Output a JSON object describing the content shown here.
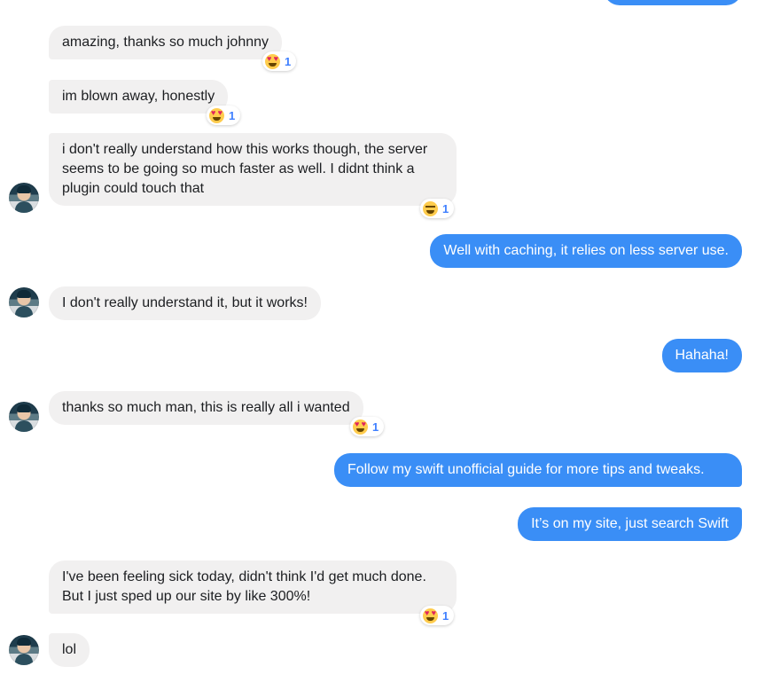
{
  "colors": {
    "incoming_bubble": "#f1f0f0",
    "outgoing_bubble": "#3a8ef6",
    "reaction_count": "#4080ff"
  },
  "messages": [
    {
      "text": "amazing, thanks so much johnny",
      "reaction": {
        "icon": "heart-eyes-emoji",
        "count": "1"
      }
    },
    {
      "text": "im blown away, honestly",
      "reaction": {
        "icon": "heart-eyes-emoji",
        "count": "1"
      }
    },
    {
      "text": "i don't really understand how this works though, the server seems to be going so much faster as well. I didnt think a plugin could touch that",
      "reaction": {
        "icon": "laughing-emoji",
        "count": "1"
      }
    },
    {
      "text": "Well with caching, it relies on less server use."
    },
    {
      "text": "I don't really understand it, but it works!"
    },
    {
      "text": "Hahaha!"
    },
    {
      "text": "thanks so much man, this is really all i wanted",
      "reaction": {
        "icon": "heart-eyes-emoji",
        "count": "1"
      }
    },
    {
      "text": "Follow my swift unofficial guide for more tips and tweaks."
    },
    {
      "text": "It’s on my site, just search Swift"
    },
    {
      "text": "I've been feeling sick today, didn't think I'd get much done. But I just sped up our site by like 300%!",
      "reaction": {
        "icon": "heart-eyes-emoji",
        "count": "1"
      }
    },
    {
      "text": "lol"
    }
  ]
}
